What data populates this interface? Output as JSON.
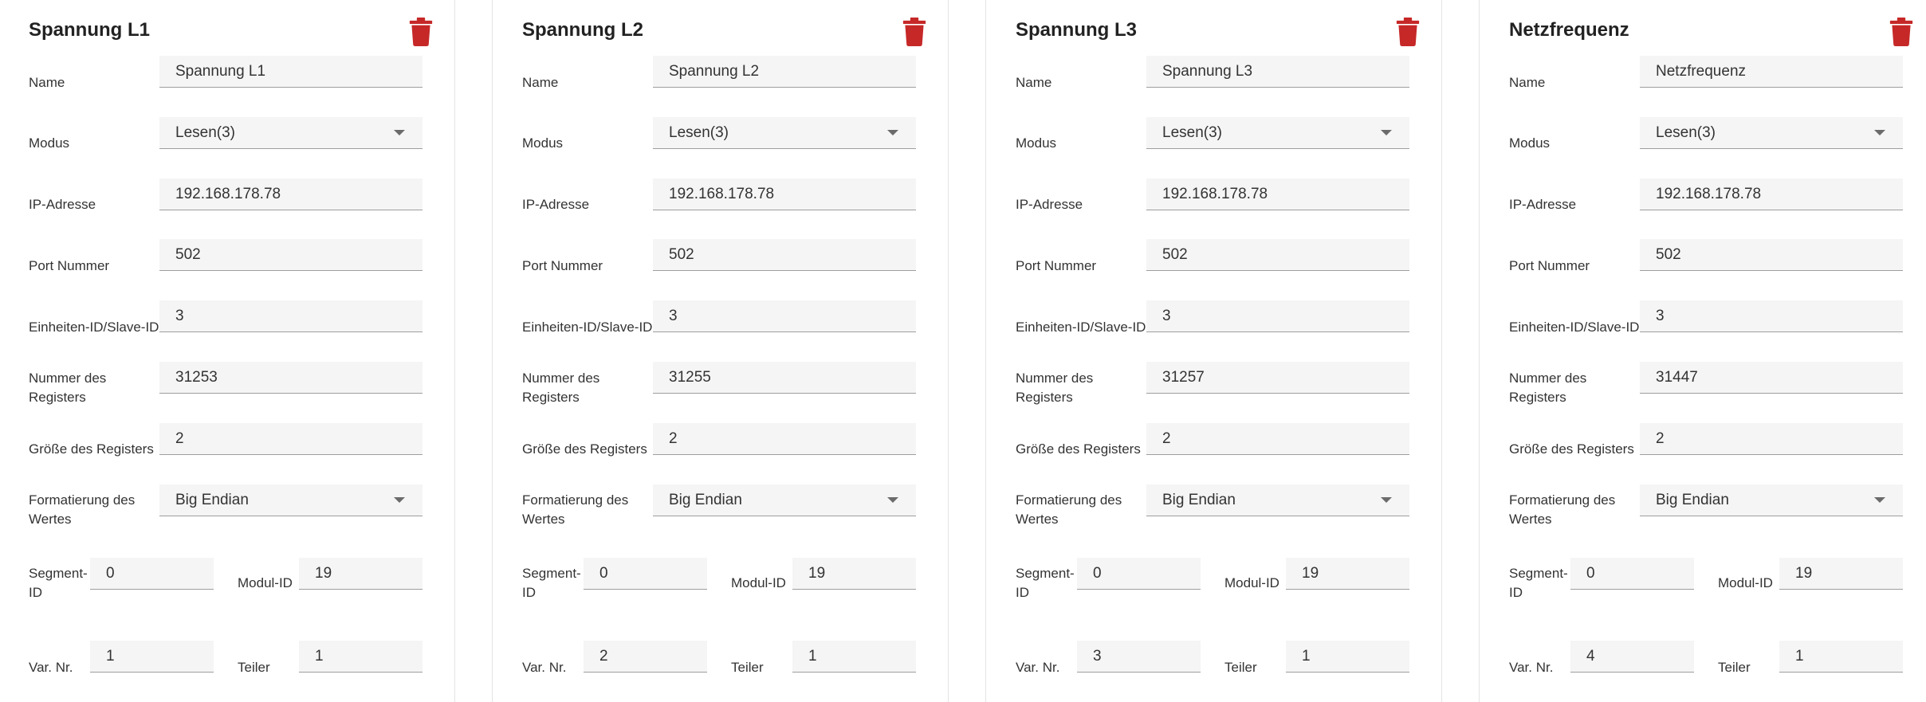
{
  "colors": {
    "accent": "#c62828",
    "field_bg": "#f5f5f5"
  },
  "labels": {
    "name": "Name",
    "mode": "Modus",
    "ip": "IP-Adresse",
    "port": "Port Nummer",
    "unit_id": "Einheiten-ID/Slave-ID",
    "register_number_1": "Nummer des",
    "register_number_2": "Registers",
    "register_size": "Größe des Registers",
    "format_1": "Formatierung des",
    "format_2": "Wertes",
    "segment_1": "Segment-",
    "segment_2": "ID",
    "module_id": "Modul-ID",
    "var_nr": "Var. Nr.",
    "divider": "Teiler"
  },
  "cards": [
    {
      "title": "Spannung L1",
      "name": "Spannung L1",
      "mode": "Lesen(3)",
      "ip": "192.168.178.78",
      "port": "502",
      "unit_id": "3",
      "register_number": "31253",
      "register_size": "2",
      "format": "Big Endian",
      "segment_id": "0",
      "module_id": "19",
      "var_nr": "1",
      "divider": "1"
    },
    {
      "title": "Spannung L2",
      "name": "Spannung L2",
      "mode": "Lesen(3)",
      "ip": "192.168.178.78",
      "port": "502",
      "unit_id": "3",
      "register_number": "31255",
      "register_size": "2",
      "format": "Big Endian",
      "segment_id": "0",
      "module_id": "19",
      "var_nr": "2",
      "divider": "1"
    },
    {
      "title": "Spannung L3",
      "name": "Spannung L3",
      "mode": "Lesen(3)",
      "ip": "192.168.178.78",
      "port": "502",
      "unit_id": "3",
      "register_number": "31257",
      "register_size": "2",
      "format": "Big Endian",
      "segment_id": "0",
      "module_id": "19",
      "var_nr": "3",
      "divider": "1"
    },
    {
      "title": "Netzfrequenz",
      "name": "Netzfrequenz",
      "mode": "Lesen(3)",
      "ip": "192.168.178.78",
      "port": "502",
      "unit_id": "3",
      "register_number": "31447",
      "register_size": "2",
      "format": "Big Endian",
      "segment_id": "0",
      "module_id": "19",
      "var_nr": "4",
      "divider": "1"
    }
  ]
}
